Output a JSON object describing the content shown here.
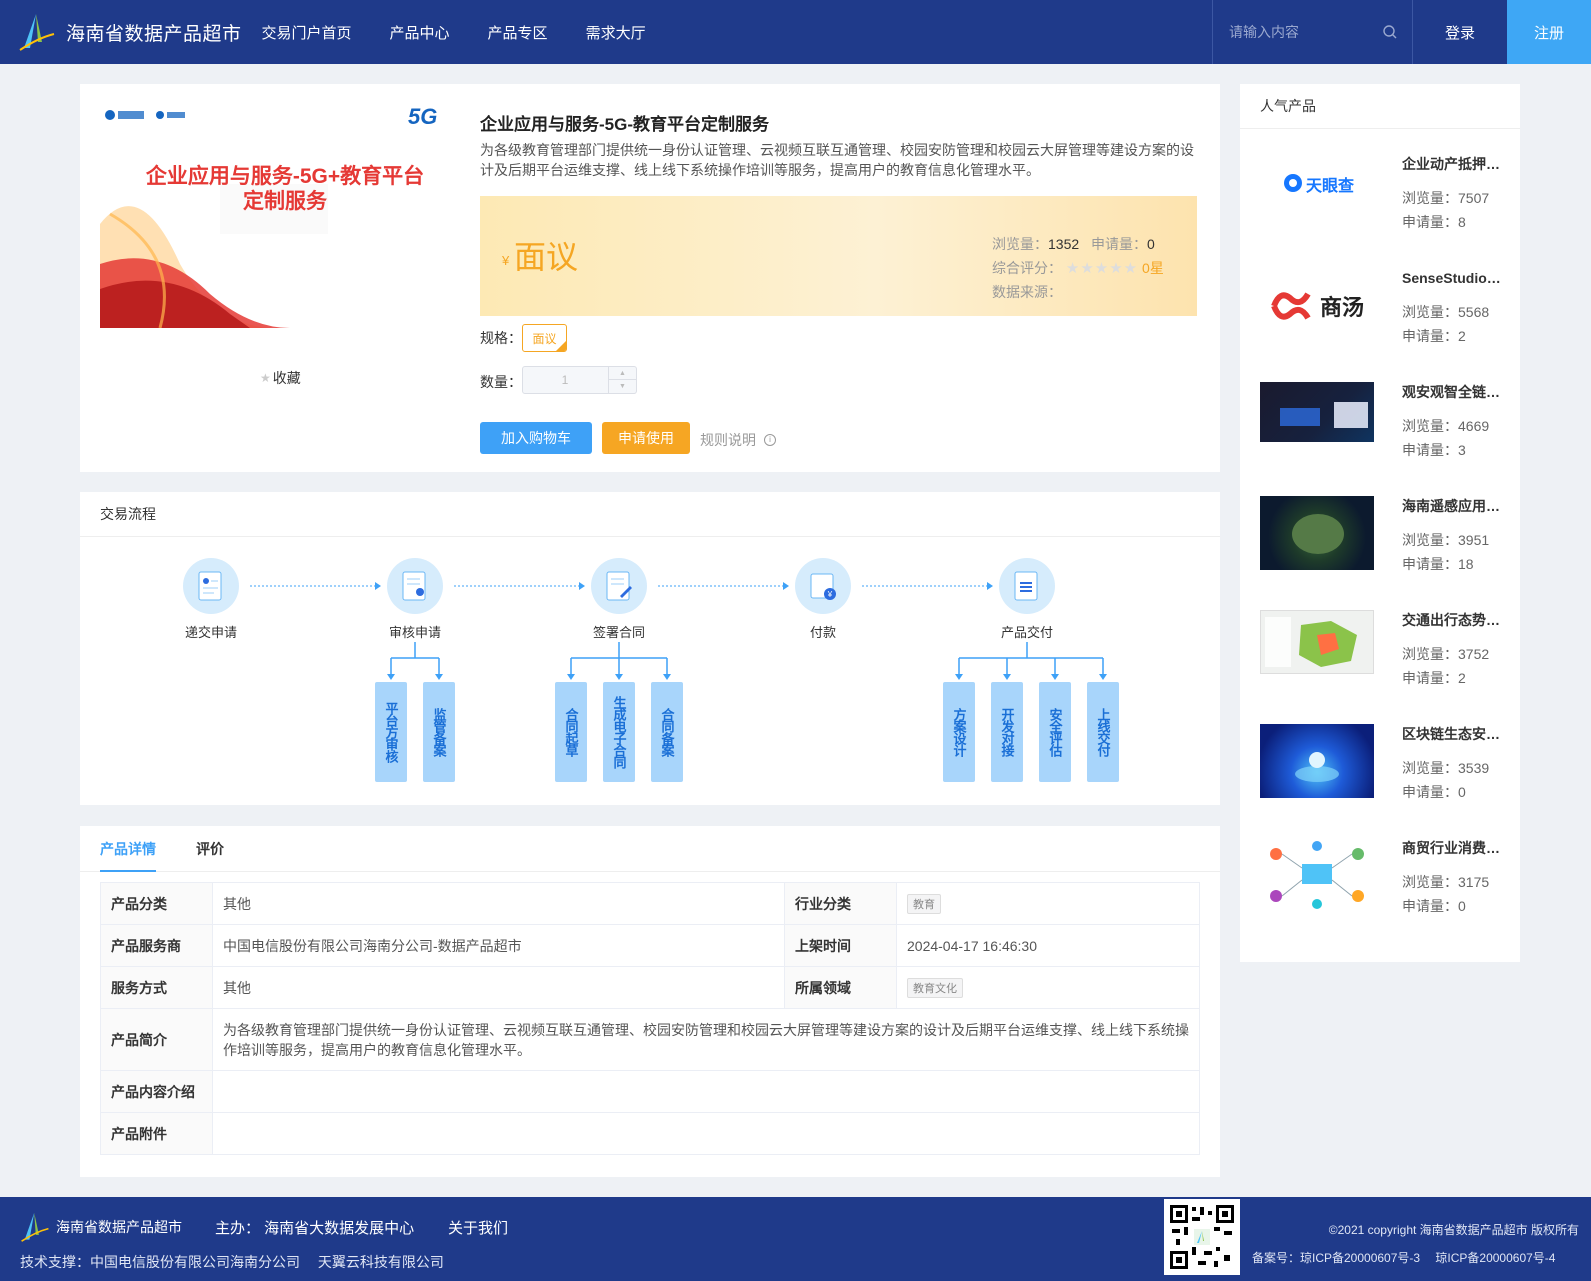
{
  "header": {
    "site_name": "海南省数据产品超市",
    "nav": [
      "交易门户首页",
      "产品中心",
      "产品专区",
      "需求大厅"
    ],
    "search_placeholder": "请输入内容",
    "login": "登录",
    "register": "注册"
  },
  "product": {
    "image_headline": "企业应用与服务-5G+教育平台定制服务",
    "image_badge": "5G",
    "favorite": "收藏",
    "title": "企业应用与服务-5G-教育平台定制服务",
    "description": "为各级教育管理部门提供统一身份认证管理、云视频互联互通管理、校园安防管理和校园云大屏管理等建设方案的设计及后期平台运维支撑、线上线下系统操作培训等服务，提高用户的教育信息化管理水平。",
    "currency": "¥",
    "price": "面议",
    "views_label": "浏览量：",
    "views": "1352",
    "applies_label": "申请量：",
    "applies": "0",
    "rating_label": "综合评分：",
    "rating_stars": 0,
    "rating_text": "0星",
    "source_label": "数据来源：",
    "spec_label": "规格：",
    "spec_value": "面议",
    "qty_label": "数量：",
    "qty_value": "1",
    "add_cart": "加入购物车",
    "apply": "申请使用",
    "rules": "规则说明"
  },
  "popular": {
    "title": "人气产品",
    "views_label": "浏览量：",
    "applies_label": "申请量：",
    "items": [
      {
        "name": "企业动产抵押信息",
        "views": "7507",
        "applies": "8",
        "thumb_text": "天眼查"
      },
      {
        "name": "SenseStudio智能平台",
        "views": "5568",
        "applies": "2",
        "thumb_text": "商汤"
      },
      {
        "name": "观安观智全链路安全",
        "views": "4669",
        "applies": "3"
      },
      {
        "name": "海南遥感应用服务",
        "views": "3951",
        "applies": "18"
      },
      {
        "name": "交通出行态势感知",
        "views": "3752",
        "applies": "2"
      },
      {
        "name": "区块链生态安全平台",
        "views": "3539",
        "applies": "0"
      },
      {
        "name": "商贸行业消费分析",
        "views": "3175",
        "applies": "0"
      }
    ]
  },
  "process": {
    "title": "交易流程",
    "steps": [
      "递交申请",
      "审核申请",
      "签署合同",
      "付款",
      "产品交付"
    ],
    "sub_review": [
      "平台方审核",
      "监管备案"
    ],
    "sub_contract": [
      "合同起草",
      "生成电子合同",
      "合同备案"
    ],
    "sub_delivery": [
      "方案设计",
      "开发对接",
      "安全评估",
      "上线交付"
    ]
  },
  "detail": {
    "tabs": [
      "产品详情",
      "评价"
    ],
    "category_label": "产品分类",
    "category": "其他",
    "industry_label": "行业分类",
    "industry": "教育",
    "provider_label": "产品服务商",
    "provider": "中国电信股份有限公司海南分公司-数据产品超市",
    "listed_label": "上架时间",
    "listed": "2024-04-17 16:46:30",
    "service_label": "服务方式",
    "service": "其他",
    "domain_label": "所属领域",
    "domain": "教育文化",
    "intro_label": "产品简介",
    "intro": "为各级教育管理部门提供统一身份认证管理、云视频互联互通管理、校园安防管理和校园云大屏管理等建设方案的设计及后期平台运维支撑、线上线下系统操作培训等服务，提高用户的教育信息化管理水平。",
    "content_label": "产品内容介绍",
    "attach_label": "产品附件"
  },
  "footer": {
    "name": "海南省数据产品超市",
    "host": "主办： 海南省大数据发展中心",
    "about": "关于我们",
    "support": "技术支撑：中国电信股份有限公司海南分公司　 天翼云科技有限公司",
    "copyright": "©2021 copyright 海南省数据产品超市 版权所有",
    "icp": "备案号：琼ICP备20000607号-3　 琼ICP备20000607号-4"
  },
  "colors": {
    "header_bg": "#1f3a8a",
    "accent_blue": "#3ea1f7",
    "accent_orange": "#f6a623"
  }
}
